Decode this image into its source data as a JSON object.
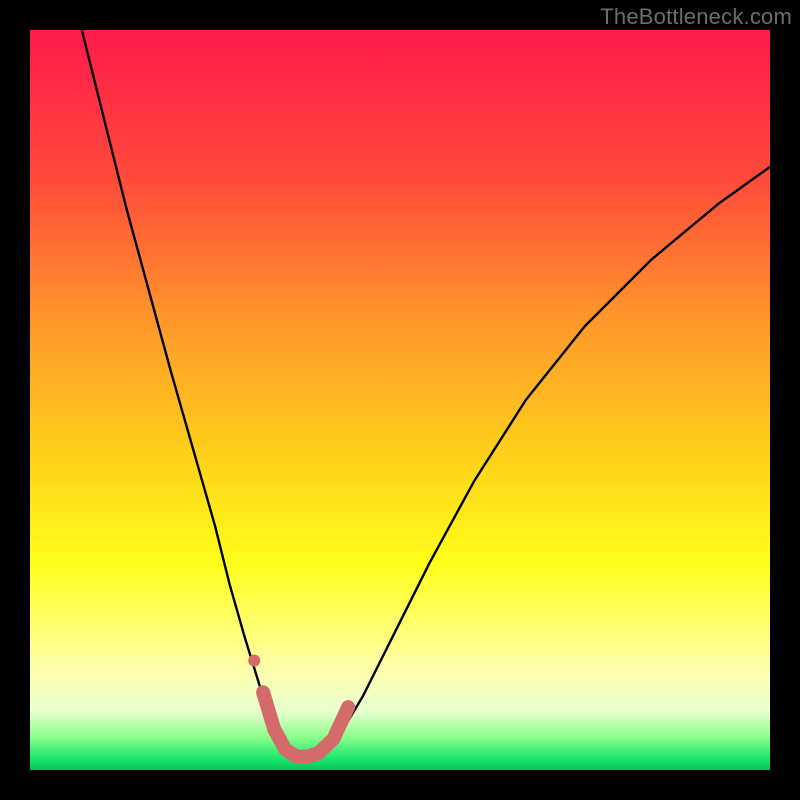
{
  "watermark": "TheBottleneck.com",
  "chart_data": {
    "type": "line",
    "title": "",
    "xlabel": "",
    "ylabel": "",
    "xlim": [
      0,
      100
    ],
    "ylim": [
      0,
      100
    ],
    "grid": false,
    "legend": false,
    "background_gradient": {
      "stops": [
        {
          "pos": 0.0,
          "color": "#ff1a4b"
        },
        {
          "pos": 0.2,
          "color": "#ff4a3a"
        },
        {
          "pos": 0.4,
          "color": "#ff9a2a"
        },
        {
          "pos": 0.58,
          "color": "#ffd21a"
        },
        {
          "pos": 0.72,
          "color": "#ffff1a"
        },
        {
          "pos": 0.86,
          "color": "#ffffa8"
        },
        {
          "pos": 0.92,
          "color": "#eaffd0"
        },
        {
          "pos": 0.955,
          "color": "#8cff8c"
        },
        {
          "pos": 0.985,
          "color": "#19e66e"
        },
        {
          "pos": 1.0,
          "color": "#08c456"
        }
      ]
    },
    "series": [
      {
        "name": "curve-left",
        "color": "#000000",
        "stroke_width": 2.4,
        "x": [
          7,
          10,
          13,
          16,
          19,
          22,
          25,
          27,
          29,
          31,
          32.5,
          34,
          35
        ],
        "y": [
          100,
          88,
          76,
          65,
          54,
          43.5,
          33,
          25,
          18,
          11.5,
          7.5,
          4,
          2.5
        ]
      },
      {
        "name": "curve-right",
        "color": "#000000",
        "stroke_width": 2.4,
        "x": [
          40,
          42,
          45,
          49,
          54,
          60,
          67,
          75,
          84,
          93,
          100
        ],
        "y": [
          2.5,
          5,
          10,
          18,
          28,
          39,
          50,
          60,
          69,
          76.5,
          81.5
        ]
      },
      {
        "name": "trough-highlight",
        "color": "#d46a6a",
        "stroke_width": 14,
        "stroke_linecap": "round",
        "x": [
          31.5,
          33,
          34.5,
          36,
          37.5,
          39,
          41,
          43
        ],
        "y": [
          10.5,
          5.5,
          2.8,
          1.8,
          1.8,
          2.3,
          4.2,
          8.5
        ]
      }
    ],
    "points": [
      {
        "name": "trough-dot",
        "x": 30.3,
        "y": 14.8,
        "r": 6,
        "color": "#d46a6a"
      }
    ]
  }
}
